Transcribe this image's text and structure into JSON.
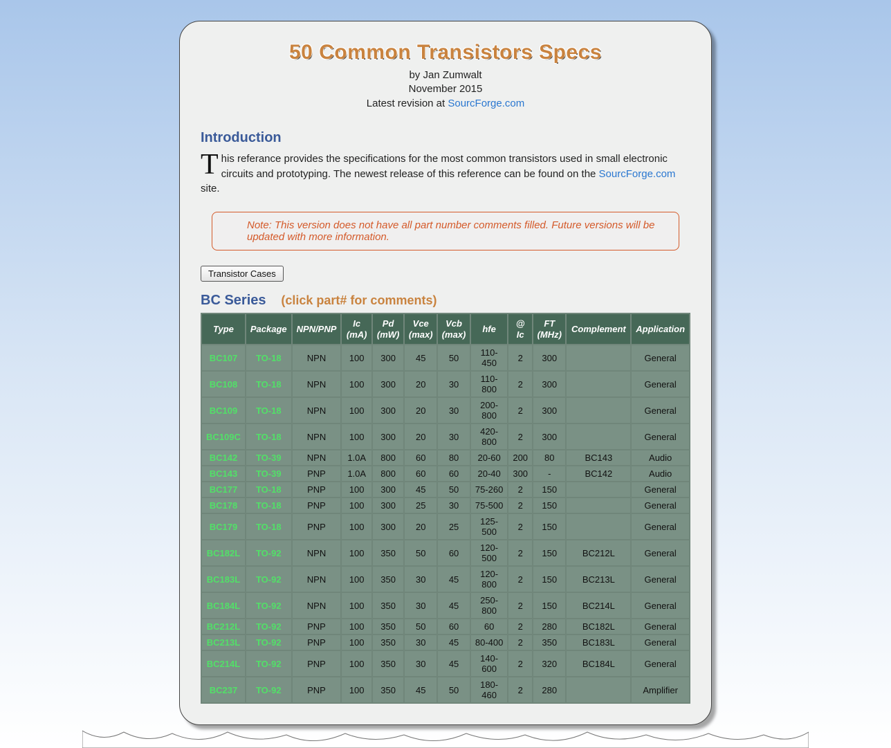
{
  "header": {
    "title": "50 Common Transistors Specs",
    "author_line": "by Jan Zumwalt",
    "date_line": "November 2015",
    "revision_prefix": "Latest revision at ",
    "revision_link_text": "SourcForge.com"
  },
  "intro": {
    "heading": "Introduction",
    "dropcap": "T",
    "body_1": "his referance provides the specifications for the most common transistors used in small electronic circuits and prototyping. The newest release of this reference can be found on the ",
    "link_text": "SourcForge.com",
    "body_2": " site."
  },
  "note": "Note: This version does not have all part number comments filled. Future versions will be updated with more information.",
  "buttons": {
    "transistor_cases": "Transistor Cases"
  },
  "series": {
    "name": "BC Series",
    "hint": "(click part# for comments)"
  },
  "columns": [
    "Type",
    "Package",
    "NPN/PNP",
    "Ic (mA)",
    "Pd (mW)",
    "Vce (max)",
    "Vcb (max)",
    "hfe",
    "@ Ic",
    "FT (MHz)",
    "Complement",
    "Application"
  ],
  "rows": [
    {
      "type": "BC107",
      "pkg": "TO-18",
      "np": "NPN",
      "ic": "100",
      "pd": "300",
      "vce": "45",
      "vcb": "50",
      "hfe": "110-450",
      "atic": "2",
      "ft": "300",
      "comp": "",
      "app": "General"
    },
    {
      "type": "BC108",
      "pkg": "TO-18",
      "np": "NPN",
      "ic": "100",
      "pd": "300",
      "vce": "20",
      "vcb": "30",
      "hfe": "110-800",
      "atic": "2",
      "ft": "300",
      "comp": "",
      "app": "General"
    },
    {
      "type": "BC109",
      "pkg": "TO-18",
      "np": "NPN",
      "ic": "100",
      "pd": "300",
      "vce": "20",
      "vcb": "30",
      "hfe": "200-800",
      "atic": "2",
      "ft": "300",
      "comp": "",
      "app": "General"
    },
    {
      "type": "BC109C",
      "pkg": "TO-18",
      "np": "NPN",
      "ic": "100",
      "pd": "300",
      "vce": "20",
      "vcb": "30",
      "hfe": "420-800",
      "atic": "2",
      "ft": "300",
      "comp": "",
      "app": "General"
    },
    {
      "type": "BC142",
      "pkg": "TO-39",
      "np": "NPN",
      "ic": "1.0A",
      "pd": "800",
      "vce": "60",
      "vcb": "80",
      "hfe": "20-60",
      "atic": "200",
      "ft": "80",
      "comp": "BC143",
      "app": "Audio"
    },
    {
      "type": "BC143",
      "pkg": "TO-39",
      "np": "PNP",
      "ic": "1.0A",
      "pd": "800",
      "vce": "60",
      "vcb": "60",
      "hfe": "20-40",
      "atic": "300",
      "ft": "-",
      "comp": "BC142",
      "app": "Audio"
    },
    {
      "type": "BC177",
      "pkg": "TO-18",
      "np": "PNP",
      "ic": "100",
      "pd": "300",
      "vce": "45",
      "vcb": "50",
      "hfe": "75-260",
      "atic": "2",
      "ft": "150",
      "comp": "",
      "app": "General"
    },
    {
      "type": "BC178",
      "pkg": "TO-18",
      "np": "PNP",
      "ic": "100",
      "pd": "300",
      "vce": "25",
      "vcb": "30",
      "hfe": "75-500",
      "atic": "2",
      "ft": "150",
      "comp": "",
      "app": "General"
    },
    {
      "type": "BC179",
      "pkg": "TO-18",
      "np": "PNP",
      "ic": "100",
      "pd": "300",
      "vce": "20",
      "vcb": "25",
      "hfe": "125-500",
      "atic": "2",
      "ft": "150",
      "comp": "",
      "app": "General"
    },
    {
      "type": "BC182L",
      "pkg": "TO-92",
      "np": "NPN",
      "ic": "100",
      "pd": "350",
      "vce": "50",
      "vcb": "60",
      "hfe": "120-500",
      "atic": "2",
      "ft": "150",
      "comp": "BC212L",
      "app": "General"
    },
    {
      "type": "BC183L",
      "pkg": "TO-92",
      "np": "NPN",
      "ic": "100",
      "pd": "350",
      "vce": "30",
      "vcb": "45",
      "hfe": "120-800",
      "atic": "2",
      "ft": "150",
      "comp": "BC213L",
      "app": "General"
    },
    {
      "type": "BC184L",
      "pkg": "TO-92",
      "np": "NPN",
      "ic": "100",
      "pd": "350",
      "vce": "30",
      "vcb": "45",
      "hfe": "250-800",
      "atic": "2",
      "ft": "150",
      "comp": "BC214L",
      "app": "General"
    },
    {
      "type": "BC212L",
      "pkg": "TO-92",
      "np": "PNP",
      "ic": "100",
      "pd": "350",
      "vce": "50",
      "vcb": "60",
      "hfe": "60",
      "atic": "2",
      "ft": "280",
      "comp": "BC182L",
      "app": "General"
    },
    {
      "type": "BC213L",
      "pkg": "TO-92",
      "np": "PNP",
      "ic": "100",
      "pd": "350",
      "vce": "30",
      "vcb": "45",
      "hfe": "80-400",
      "atic": "2",
      "ft": "350",
      "comp": "BC183L",
      "app": "General"
    },
    {
      "type": "BC214L",
      "pkg": "TO-92",
      "np": "PNP",
      "ic": "100",
      "pd": "350",
      "vce": "30",
      "vcb": "45",
      "hfe": "140-600",
      "atic": "2",
      "ft": "320",
      "comp": "BC184L",
      "app": "General"
    },
    {
      "type": "BC237",
      "pkg": "TO-92",
      "np": "PNP",
      "ic": "100",
      "pd": "350",
      "vce": "45",
      "vcb": "50",
      "hfe": "180-460",
      "atic": "2",
      "ft": "280",
      "comp": "",
      "app": "Amplifier"
    }
  ]
}
